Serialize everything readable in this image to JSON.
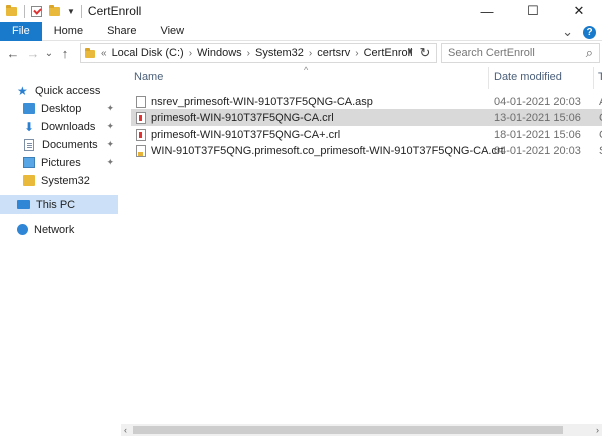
{
  "window": {
    "title": "CertEnroll",
    "minimize": "—",
    "maximize": "☐",
    "close": "✕"
  },
  "ribbon": {
    "tabs": [
      "File",
      "Home",
      "Share",
      "View"
    ],
    "expand": "⌄",
    "help": "?"
  },
  "nav": {
    "back": "←",
    "forward": "→",
    "recent": "⌄",
    "up": "↑",
    "breadcrumb": [
      "Local Disk (C:)",
      "Windows",
      "System32",
      "certsrv",
      "CertEnroll"
    ],
    "overflow": "«",
    "search_placeholder": "Search CertEnroll",
    "search_icon": "⌕",
    "refresh": "↻"
  },
  "sidebar": {
    "items": [
      {
        "label": "Quick access",
        "icon": "star-icon"
      },
      {
        "label": "Desktop",
        "icon": "desktop-icon",
        "pinned": true
      },
      {
        "label": "Downloads",
        "icon": "download-icon",
        "pinned": true
      },
      {
        "label": "Documents",
        "icon": "documents-icon",
        "pinned": true
      },
      {
        "label": "Pictures",
        "icon": "pictures-icon",
        "pinned": true
      },
      {
        "label": "System32",
        "icon": "folder-icon"
      },
      {
        "label": "This PC",
        "icon": "computer-icon",
        "selected": true
      },
      {
        "label": "Network",
        "icon": "network-icon"
      }
    ],
    "pin_glyph": "📌"
  },
  "columns": {
    "name": "Name",
    "date": "Date modified",
    "type": "T"
  },
  "files": [
    {
      "name": "nsrev_primesoft-WIN-910T37F5QNG-CA.asp",
      "date": "04-01-2021 20:03",
      "type": "A",
      "icon": "file-icon"
    },
    {
      "name": "primesoft-WIN-910T37F5QNG-CA.crl",
      "date": "13-01-2021 15:06",
      "type": "C",
      "icon": "crl-file-icon",
      "selected": true
    },
    {
      "name": "primesoft-WIN-910T37F5QNG-CA+.crl",
      "date": "18-01-2021 15:06",
      "type": "C",
      "icon": "crl-file-icon"
    },
    {
      "name": "WIN-910T37F5QNG.primesoft.co_primesoft-WIN-910T37F5QNG-CA.crt",
      "date": "04-01-2021 20:03",
      "type": "S",
      "icon": "certificate-file-icon"
    }
  ],
  "scrollbar": {
    "left": "‹",
    "right": "›"
  }
}
